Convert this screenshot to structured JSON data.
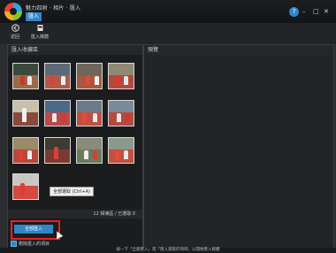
{
  "app": {
    "breadcrumb": "魅力四射 · 相片 · 匯入",
    "active_tab": "匯入",
    "help": "?",
    "minimize": "–",
    "maximize": "□",
    "close": "✕"
  },
  "toolbar": {
    "items": [
      {
        "label": "返回",
        "icon": "back-arrow-icon"
      },
      {
        "label": "匯入媒體",
        "icon": "import-media-icon"
      }
    ]
  },
  "left_panel": {
    "title": "匯入收藏區",
    "status": "12 相簿區 / 已選取 0",
    "select_all_label": "全部匯入",
    "checkbox_label": "刪除匯入的項目",
    "tooltip": "全部選取 (Ctrl+A)"
  },
  "right_panel": {
    "title": "預覽"
  },
  "footer": {
    "hint": "按一下「全部匯入」或「匯入選取的項目」以開始匯入媒體"
  },
  "colors": {
    "accent": "#2f86c8",
    "highlight": "#e8202a"
  }
}
